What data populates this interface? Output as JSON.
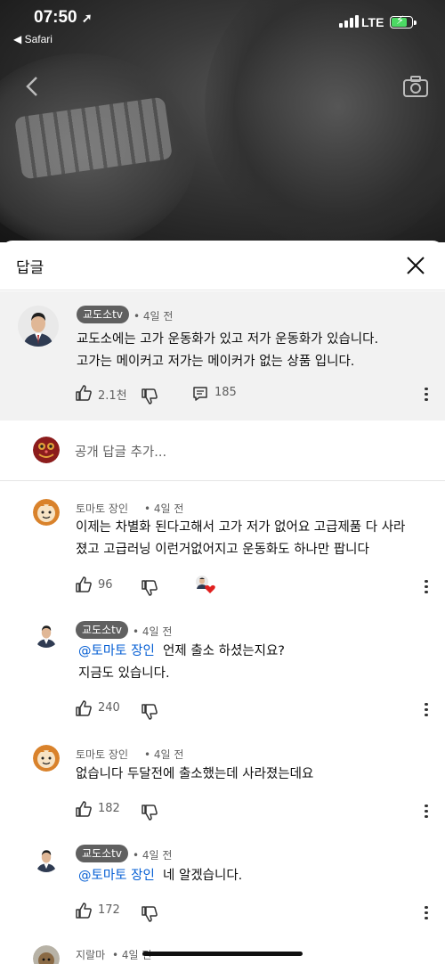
{
  "status_bar": {
    "time": "07:50",
    "back_app": "◀ Safari",
    "network": "LTE"
  },
  "sheet": {
    "title": "답글"
  },
  "parent_comment": {
    "author": "교도소tv",
    "age": "• 4일 전",
    "lines": [
      "교도소에는 고가 운동화가 있고 저가 운동화가 있습니다.",
      "고가는 메이커고 저가는 메이커가 없는 상품 입니다."
    ],
    "likes": "2.1천",
    "replies": "185"
  },
  "add_reply": {
    "placeholder": "공개 답글 추가..."
  },
  "replies": [
    {
      "author": "토마토 장인",
      "age": "• 4일 전",
      "lines": [
        "이제는 차별화 된다고해서 고가 저가 없어요 고급제품 다 사라",
        "졌고 고급러닝 이런거없어지고 운동화도 하나만 팝니다"
      ],
      "likes": "96"
    },
    {
      "author": "교도소tv",
      "age": "• 4일 전",
      "mention": "@토마토 장인",
      "lines": [
        "언제 출소 하셨는지요?",
        "지금도 있습니다."
      ],
      "likes": "240"
    },
    {
      "author": "토마토 장인",
      "age": "• 4일 전",
      "lines": [
        "없습니다 두달전에 출소했는데 사라졌는데요"
      ],
      "likes": "182"
    },
    {
      "author": "교도소tv",
      "age": "• 4일 전",
      "mention": "@토마토 장인",
      "lines": [
        "네 알겠습니다."
      ],
      "likes": "172"
    },
    {
      "author": "지랄마",
      "age": "• 4일 전"
    }
  ],
  "colors": {
    "mention": "#065fd4",
    "author_badge": "#606060",
    "heart": "#e0201f"
  }
}
